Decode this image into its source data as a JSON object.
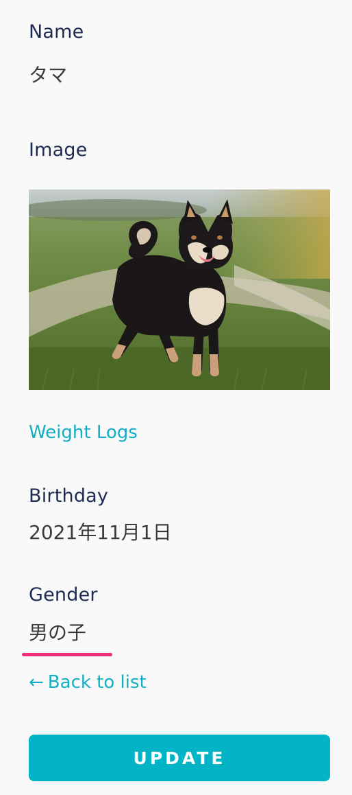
{
  "fields": {
    "name": {
      "label": "Name",
      "value": "タマ"
    },
    "image": {
      "label": "Image"
    },
    "birthday": {
      "label": "Birthday",
      "value": "2021年11月1日"
    },
    "gender": {
      "label": "Gender",
      "value": "男の子"
    }
  },
  "links": {
    "weight_logs": "Weight Logs",
    "back_arrow": "←",
    "back_to_list": "Back to list"
  },
  "actions": {
    "update": "UPDATE"
  },
  "photo": {
    "subject": "black-and-tan shiba inu standing on grassy path"
  },
  "colors": {
    "background": "#f9f9f9",
    "label_text": "#1e2a52",
    "link": "#12afc4",
    "button": "#03b3c6",
    "underline": "#f02c7c"
  }
}
